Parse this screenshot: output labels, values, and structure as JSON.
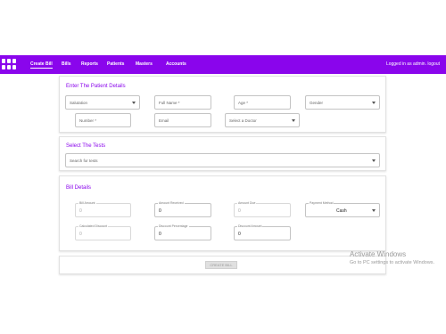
{
  "navbar": {
    "items": [
      {
        "label": "Create Bill",
        "active": true
      },
      {
        "label": "Bills"
      },
      {
        "label": "Reports"
      },
      {
        "label": "Patients"
      },
      {
        "label": "Masters"
      },
      {
        "label": "Accounts"
      }
    ],
    "user_text": "Logged in as admin.",
    "logout_label": "logout",
    "logo_icon": "grid-logo-icon",
    "accent_color": "#8a05ec"
  },
  "patient": {
    "title": "Enter The Patient Details",
    "salutation_placeholder": "Salutation",
    "fullname_placeholder": "Full Name *",
    "age_placeholder": "Age *",
    "gender_placeholder": "Gender",
    "number_placeholder": "Number *",
    "email_placeholder": "Email",
    "doctor_placeholder": "Select a Doctor"
  },
  "tests": {
    "title": "Select The Tests",
    "search_placeholder": "Search for tests"
  },
  "bill": {
    "title": "Bill Details",
    "bill_amount": {
      "label": "Bill Amount",
      "value": "0"
    },
    "amount_received": {
      "label": "Amount Received",
      "value": "0"
    },
    "amount_due": {
      "label": "Amount Due",
      "value": "0"
    },
    "payment_method": {
      "label": "Payment Method",
      "value": "Cash"
    },
    "calculated_discount": {
      "label": "Calculated Discount",
      "value": "0"
    },
    "discount_percentage": {
      "label": "Discount Percentage",
      "value": "0"
    },
    "discount_amount": {
      "label": "Discount Amount",
      "value": "0"
    }
  },
  "actions": {
    "create_bill_label": "CREATE BILL"
  },
  "watermark": {
    "line1": "Activate Windows",
    "line2": "Go to PC settings to activate Windows."
  }
}
